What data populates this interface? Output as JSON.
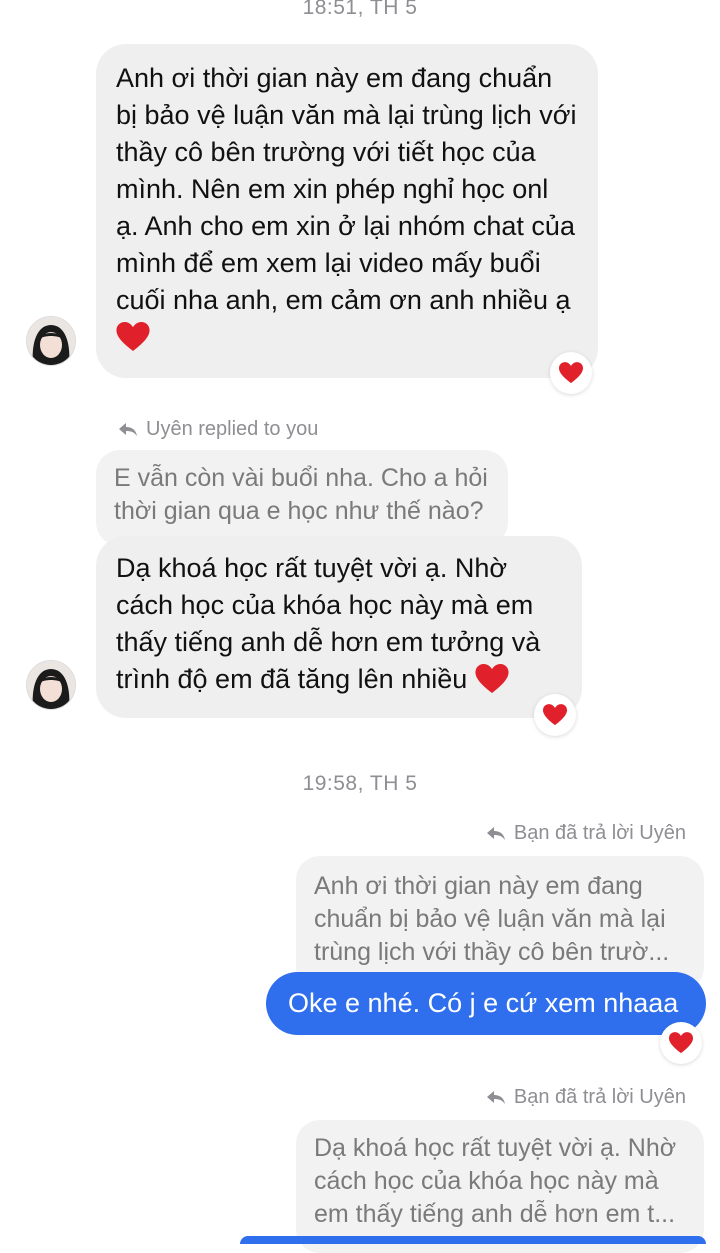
{
  "timestamps": {
    "first": "18:51, TH 5",
    "second": "19:58, TH 5"
  },
  "messages": {
    "incoming_1": "Anh ơi thời gian này em đang chuẩn bị bảo vệ luận văn mà lại trùng lịch với thầy cô bên trường với tiết học của mình. Nên em xin phép nghỉ học onl ạ. Anh cho em xin ở lại nhóm chat của mình để em xem lại video mấy buổi cuối nha anh, em cảm ơn anh nhiều ạ",
    "reply_label_1": "Uyên replied to you",
    "quoted_1": "E vẫn còn vài buổi nha. Cho a hỏi thời gian qua e học như thế nào?",
    "incoming_2": "Dạ khoá học rất tuyệt vời ạ. Nhờ cách học của khóa học này mà em thấy tiếng anh dễ hơn em tưởng và trình độ em đã tăng lên nhiều",
    "reply_label_2": "Bạn đã trả lời Uyên",
    "quoted_2": "Anh ơi thời gian này em đang chuẩn bị bảo vệ luận văn mà lại trùng lịch với thầy cô bên trườ...",
    "outgoing_1": "Oke e nhé. Có j e cứ xem nhaaa",
    "reply_label_3": "Bạn đã trả lời Uyên",
    "quoted_3": "Dạ khoá học rất tuyệt vời ạ. Nhờ cách học của khóa học này mà em thấy tiếng anh dễ hơn em t..."
  },
  "reactions": {
    "emoji": "heart"
  },
  "colors": {
    "outgoing_bubble": "#2f6fed",
    "incoming_bubble": "#efefef",
    "heart": "#e0202a"
  }
}
